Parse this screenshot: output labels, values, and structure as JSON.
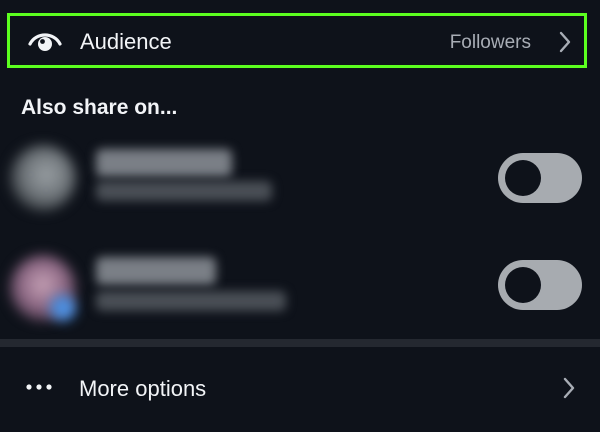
{
  "audience": {
    "label": "Audience",
    "value": "Followers",
    "icon": "eye-icon",
    "highlight_color": "#5cff1f"
  },
  "share_section": {
    "title": "Also share on...",
    "accounts": [
      {
        "toggle_on": false
      },
      {
        "toggle_on": false
      }
    ]
  },
  "more_options": {
    "label": "More options",
    "icon": "more-dots-icon"
  },
  "colors": {
    "background": "#0e121a",
    "primary_text": "#f2f4f7",
    "secondary_text": "#a8adb5",
    "toggle_track": "#a7abb0"
  }
}
